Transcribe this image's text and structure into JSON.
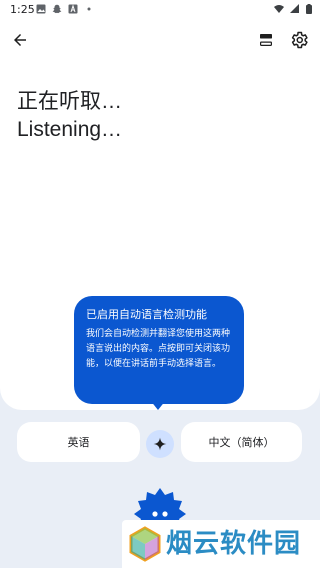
{
  "status_bar": {
    "time": "1:25"
  },
  "heading": {
    "line1": "正在听取…",
    "line2": "Listening…"
  },
  "tooltip": {
    "title": "已启用自动语言检测功能",
    "body": "我们会自动检测并翻译您使用这两种语言说出的内容。点按即可关闭该功能，以便在讲话前手动选择语言。"
  },
  "languages": {
    "source": "英语",
    "target": "中文（简体）"
  },
  "watermark": {
    "text": "烟云软件园"
  },
  "colors": {
    "accent": "#0b57d0",
    "background": "#e9eef6",
    "chip": "#ffffff",
    "swap": "#cfe0ff"
  },
  "icons": {
    "back": "arrow-left-icon",
    "layout": "split-screen-icon",
    "settings": "gear-icon",
    "swap": "sparkle-icon",
    "mic": "mic-blob-icon"
  }
}
